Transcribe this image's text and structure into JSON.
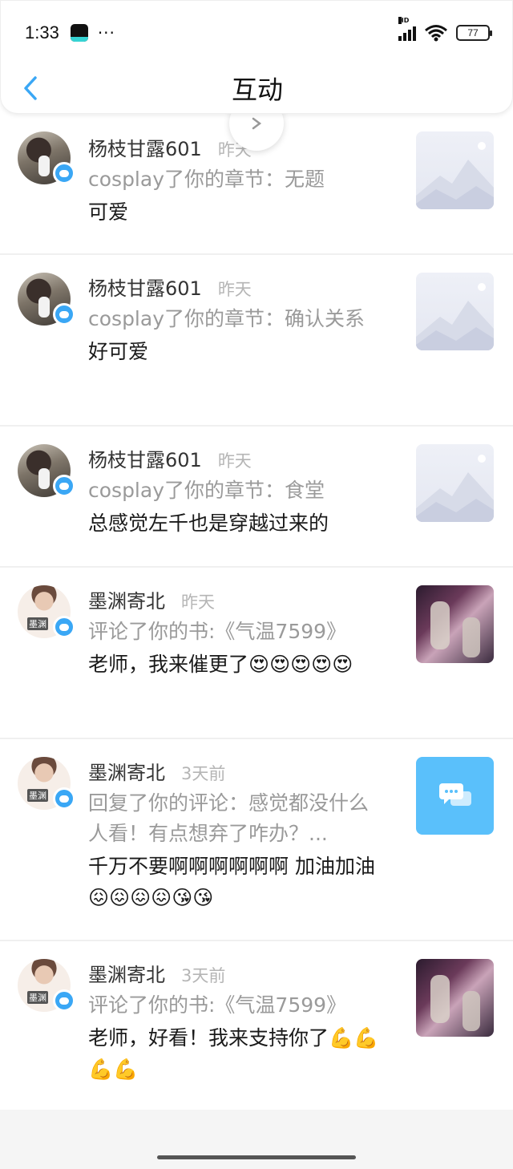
{
  "status_bar": {
    "time": "1:33",
    "signal_label": "HD",
    "battery": "77",
    "dots": "···"
  },
  "header": {
    "title": "互动"
  },
  "items": [
    {
      "name": "杨枝甘露601",
      "time": "昨天",
      "action": "cosplay了你的章节：无题",
      "comment": "可爱",
      "avatar": "girl",
      "thumb": "placeholder"
    },
    {
      "name": "杨枝甘露601",
      "time": "昨天",
      "action": "cosplay了你的章节：确认关系",
      "comment": "好可爱",
      "avatar": "girl",
      "thumb": "placeholder"
    },
    {
      "name": "杨枝甘露601",
      "time": "昨天",
      "action": "cosplay了你的章节：食堂",
      "comment": "总感觉左千也是穿越过来的",
      "avatar": "girl",
      "thumb": "placeholder"
    },
    {
      "name": "墨渊寄北",
      "time": "昨天",
      "action": "评论了你的书:《气温7599》",
      "comment": "老师，我来催更了😍😍😍😍😍",
      "avatar": "boy",
      "thumb": "photo"
    },
    {
      "name": "墨渊寄北",
      "time": "3天前",
      "action": "回复了你的评论：感觉都没什么人看！有点想弃了咋办？...",
      "comment": "千万不要啊啊啊啊啊啊 加油加油😖😖😖😖😘😘",
      "avatar": "boy",
      "thumb": "chat"
    },
    {
      "name": "墨渊寄北",
      "time": "3天前",
      "action": "评论了你的书:《气温7599》",
      "comment": "老师，好看！我来支持你了💪💪💪💪",
      "avatar": "boy",
      "thumb": "photo"
    }
  ],
  "icons": {
    "back": "chevron-left-icon",
    "badge": "comment-bubble-icon",
    "chat_thumb": "chat-bubbles-icon"
  },
  "colors": {
    "accent": "#3aa7f5",
    "chat_thumb": "#5ac0fb",
    "time_text": "#b5b5b5",
    "action_text": "#9a9a9a"
  }
}
